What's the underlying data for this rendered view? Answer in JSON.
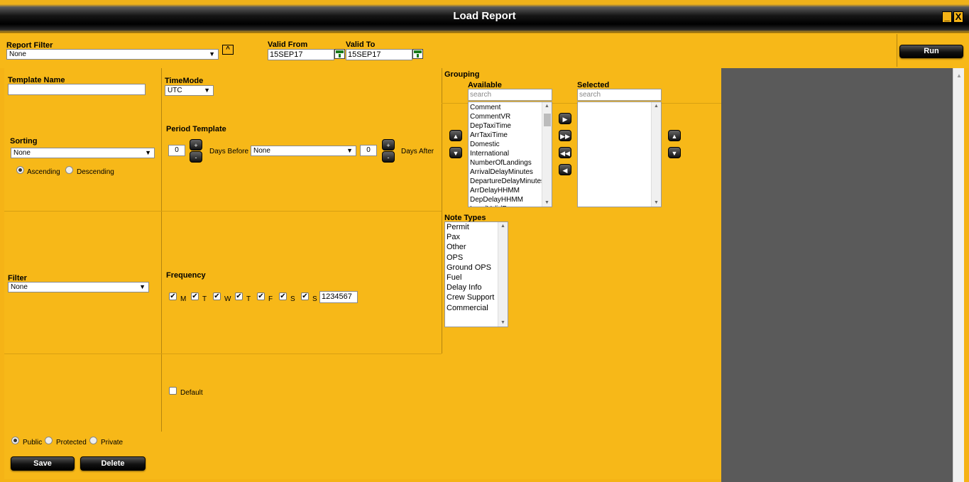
{
  "window": {
    "title": "Load Report",
    "minimize_glyph": "_",
    "close_glyph": "X"
  },
  "header": {
    "report_filter_label": "Report Filter",
    "report_filter_value": "None",
    "valid_from_label": "Valid From",
    "valid_from_value": "15SEP17",
    "valid_to_label": "Valid To",
    "valid_to_value": "15SEP17",
    "run_label": "Run"
  },
  "template": {
    "name_label": "Template Name",
    "name_value": ""
  },
  "timemode": {
    "label": "TimeMode",
    "value": "UTC"
  },
  "sorting": {
    "label": "Sorting",
    "value": "None",
    "ascending_label": "Ascending",
    "descending_label": "Descending"
  },
  "period": {
    "label": "Period Template",
    "days_before_value": "0",
    "days_before_label": "Days Before",
    "template_value": "None",
    "days_after_value": "0",
    "days_after_label": "Days After",
    "plus": "+",
    "minus": "-"
  },
  "grouping": {
    "label": "Grouping",
    "available_label": "Available",
    "selected_label": "Selected",
    "search_placeholder": "search",
    "available_items": [
      "Comment",
      "CommentVR",
      "DepTaxiTime",
      "ArrTaxiTime",
      "Domestic",
      "International",
      "NumberOfLandings",
      "ArrivalDelayMinutes",
      "DepartureDelayMinutes",
      "ArrDelayHHMM",
      "DepDelayHHMM",
      "LocalValidFrom"
    ]
  },
  "note_types": {
    "label": "Note Types",
    "items": [
      "Permit",
      "Pax",
      "Other",
      "OPS",
      "Ground OPS",
      "Fuel",
      "Delay Info",
      "Crew Support",
      "Commercial"
    ]
  },
  "filter": {
    "label": "Filter",
    "value": "None"
  },
  "frequency": {
    "label": "Frequency",
    "days": [
      "M",
      "T",
      "W",
      "T",
      "F",
      "S",
      "S"
    ],
    "value": "1234567"
  },
  "default_label": "Default",
  "visibility": {
    "public_label": "Public",
    "protected_label": "Protected",
    "private_label": "Private"
  },
  "actions": {
    "save_label": "Save",
    "delete_label": "Delete"
  }
}
